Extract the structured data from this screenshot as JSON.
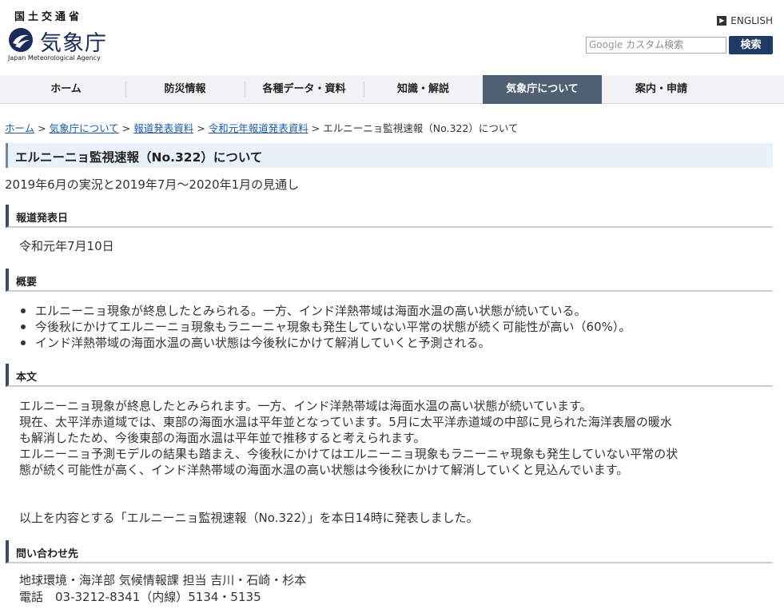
{
  "header": {
    "ministry": "国土交通省",
    "agency": "気象庁",
    "agency_en": "Japan Meteorological Agency",
    "english_link": "ENGLISH",
    "search_google": "Google",
    "search_placeholder": "カスタム検索",
    "search_button": "検索"
  },
  "nav": {
    "items": [
      "ホーム",
      "防災情報",
      "各種データ・資料",
      "知識・解説",
      "気象庁について",
      "案内・申請"
    ],
    "active_index": 4
  },
  "breadcrumb": {
    "links": [
      "ホーム",
      "気象庁について",
      "報道発表資料",
      "令和元年報道発表資料"
    ],
    "current": "エルニーニョ監視速報（No.322）について",
    "separator": ">"
  },
  "page": {
    "title": "エルニーニョ監視速報（No.322）について",
    "subtitle": "2019年6月の実況と2019年7月～2020年1月の見通し"
  },
  "sections": {
    "release_date": {
      "heading": "報道発表日",
      "value": "令和元年7月10日"
    },
    "summary": {
      "heading": "概要",
      "items": [
        "エルニーニョ現象が終息したとみられる。一方、インド洋熱帯域は海面水温の高い状態が続いている。",
        "今後秋にかけてエルニーニョ現象もラニーニャ現象も発生していない平常の状態が続く可能性が高い（60%）。",
        "インド洋熱帯域の海面水温の高い状態は今後秋にかけて解消していくと予測される。"
      ]
    },
    "body": {
      "heading": "本文",
      "lines": [
        "エルニーニョ現象が終息したとみられます。一方、インド洋熱帯域は海面水温の高い状態が続いています。",
        "現在、太平洋赤道域では、東部の海面水温は平年並となっています。5月に太平洋赤道域の中部に見られた海洋表層の暖水",
        "も解消したため、今後東部の海面水温は平年並で推移すると考えられます。",
        "エルニーニョ予測モデルの結果も踏まえ、今後秋にかけてはエルニーニョ現象もラニーニャ現象も発生していない平常の状",
        "態が続く可能性が高く、インド洋熱帯域の海面水温の高い状態は今後秋にかけて解消していくと見込んでいます。"
      ],
      "closing": "以上を内容とする「エルニーニョ監視速報（No.322）」を本日14時に発表しました。"
    },
    "contact": {
      "heading": "問い合わせ先",
      "lines": [
        "地球環境・海洋部 気候情報課 担当 吉川・石崎・杉本",
        "電話　03-3212-8341（内線）5134・5135"
      ]
    }
  },
  "colors": {
    "nav_active": "#4e6072",
    "search_button": "#1f3a63",
    "link": "#1f5aa8",
    "title_bg": "#e9f1fa",
    "section_bar": "#3b4d66"
  }
}
